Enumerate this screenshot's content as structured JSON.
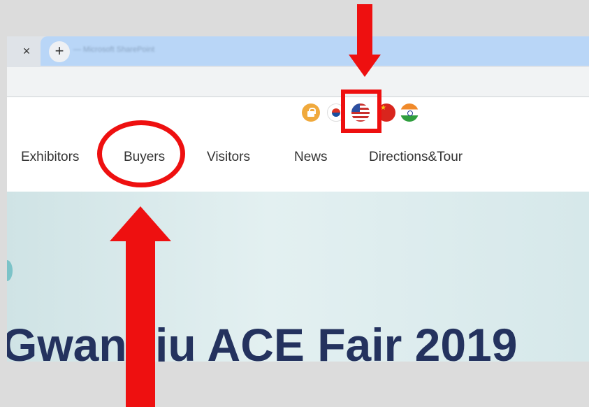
{
  "browser": {
    "tab_close": "×",
    "new_tab": "+",
    "tab_title": "— Microsoft SharePoint"
  },
  "header": {
    "languages": [
      {
        "name": "lock-icon"
      },
      {
        "name": "korea-flag"
      },
      {
        "name": "usa-flag"
      },
      {
        "name": "china-flag"
      },
      {
        "name": "india-flag"
      }
    ],
    "nav": [
      "Exhibitors",
      "Buyers",
      "Visitors",
      "News",
      "Directions&Tour"
    ]
  },
  "hero": {
    "title": "Gwangju ACE Fair 2019"
  },
  "colors": {
    "annotation_red": "#ee1010",
    "hero_bg": "#d6e8ea",
    "title_navy": "#24325e"
  }
}
